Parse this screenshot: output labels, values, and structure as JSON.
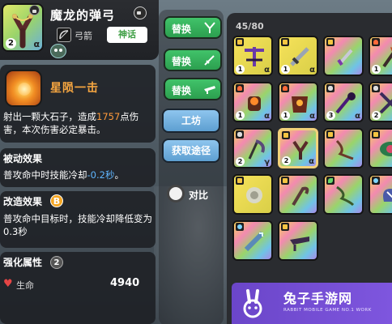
{
  "weapon": {
    "name": "魔龙的弹弓",
    "level": "2",
    "rank": "α",
    "type_label": "弓箭",
    "rarity_label": "神话"
  },
  "skill": {
    "name": "星陨一击",
    "desc_before": "射出一颗大石子，造成",
    "damage": "1757",
    "desc_after": "点伤害，本次伤害必定暴击。"
  },
  "passive": {
    "title": "被动效果",
    "desc_before": "普攻命中时技能冷却",
    "value": "-0.2秒",
    "desc_after": "。"
  },
  "modify": {
    "title": "改造效果",
    "badge": "B",
    "desc": "普攻命中目标时，技能冷却降低变为0.3秒"
  },
  "attributes": {
    "title": "强化属性",
    "count": "2",
    "stat_label": "生命",
    "stat_value": "4940"
  },
  "middle": {
    "replace_buttons": [
      "替换",
      "替换",
      "替换"
    ],
    "workshop_label": "工坊",
    "obtain_label": "获取途径",
    "compare_label": "对比"
  },
  "inventory": {
    "count": "45/80",
    "items": [
      {
        "name": "purple-crossbow",
        "bg": "yellow",
        "lvl": "1",
        "rank": "α",
        "tag": "bolt"
      },
      {
        "name": "sword",
        "bg": "yellow",
        "lvl": "1",
        "rank": "α",
        "tag": "bolt"
      },
      {
        "name": "dagger",
        "bg": "rainbow",
        "lvl": "",
        "rank": "",
        "tag": "bolt"
      },
      {
        "name": "battle-axe",
        "bg": "rainbow",
        "lvl": "1",
        "rank": "α",
        "tag": "flame"
      },
      {
        "name": "fire-gauntlet",
        "bg": "rainbow",
        "lvl": "1",
        "rank": "α",
        "tag": "flame"
      },
      {
        "name": "fire-armor",
        "bg": "rainbow",
        "lvl": "1",
        "rank": "α",
        "tag": "flame"
      },
      {
        "name": "shadow-wand",
        "bg": "rainbow",
        "lvl": "3",
        "rank": "α",
        "tag": "skull"
      },
      {
        "name": "twin-blade",
        "bg": "rainbow",
        "lvl": "2",
        "rank": "α",
        "tag": "skull"
      },
      {
        "name": "scythe",
        "bg": "rainbow",
        "lvl": "2",
        "rank": "γ",
        "tag": "skull"
      },
      {
        "name": "slingshot",
        "bg": "rainbow",
        "lvl": "2",
        "rank": "α",
        "tag": "bolt"
      },
      {
        "name": "chain-whip",
        "bg": "rainbow",
        "lvl": "",
        "rank": "",
        "tag": "bolt"
      },
      {
        "name": "eye-relic",
        "bg": "rainbow",
        "lvl": "",
        "rank": "",
        "tag": "bolt"
      },
      {
        "name": "spike-ball",
        "bg": "yellow",
        "lvl": "",
        "rank": "",
        "tag": "bolt"
      },
      {
        "name": "hook-blade",
        "bg": "rainbow",
        "lvl": "",
        "rank": "",
        "tag": "bolt"
      },
      {
        "name": "thorn-whip",
        "bg": "rainbow",
        "lvl": "",
        "rank": "",
        "tag": "leaf"
      },
      {
        "name": "crab-claw",
        "bg": "rainbow",
        "lvl": "",
        "rank": "",
        "tag": "snow"
      },
      {
        "name": "ice-drill",
        "bg": "rainbow",
        "lvl": "",
        "rank": "",
        "tag": "snow"
      },
      {
        "name": "dark-gun",
        "bg": "rainbow",
        "lvl": "",
        "rank": "",
        "tag": "bolt"
      }
    ]
  },
  "watermark": {
    "title": "兔子手游网",
    "subtitle": "RABBIT MOBILE GAME NO.1 WORK"
  },
  "colors": {
    "accent_orange": "#f6a640",
    "replace_green": "#3bb862",
    "button_blue": "#74b3e2",
    "rarity_green": "#3f9f45",
    "cooldown_blue": "#5fb6ff"
  }
}
